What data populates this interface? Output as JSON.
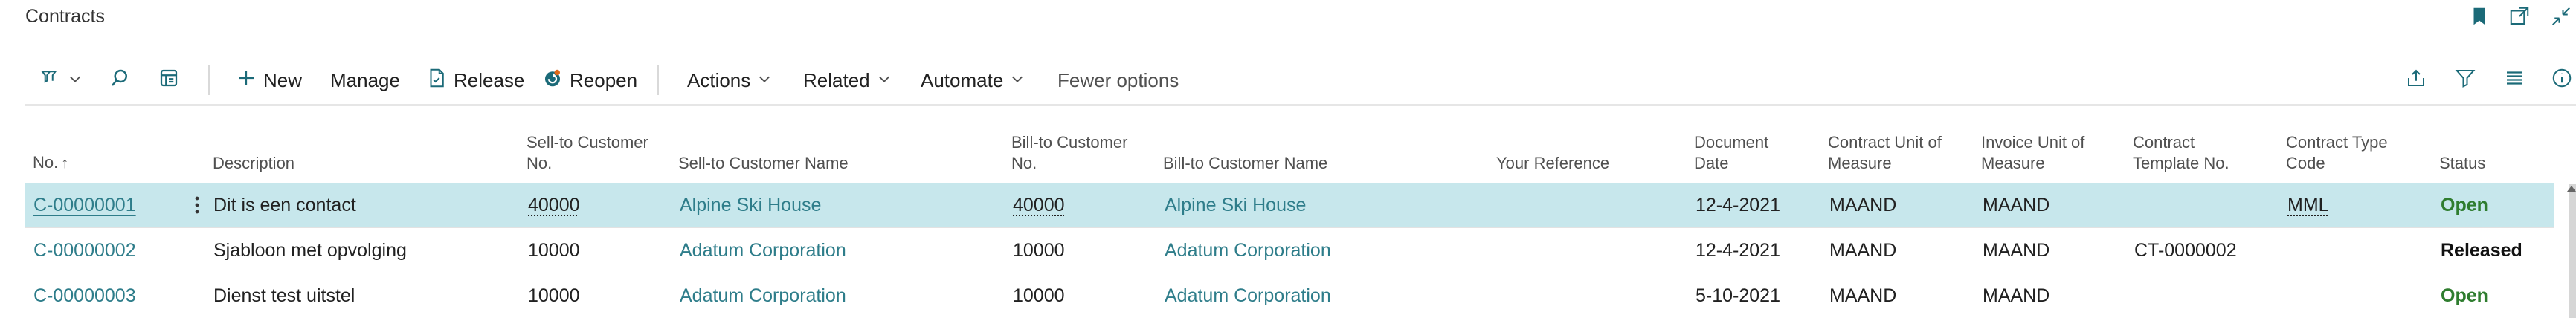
{
  "page": {
    "title": "Contracts"
  },
  "title_icons": [
    "bookmark-icon",
    "open-new-window-icon",
    "collapse-icon"
  ],
  "actionbar": {
    "new_label": "New",
    "manage_label": "Manage",
    "release_label": "Release",
    "reopen_label": "Reopen",
    "actions_label": "Actions",
    "related_label": "Related",
    "automate_label": "Automate",
    "fewer_options_label": "Fewer options"
  },
  "table": {
    "headers": {
      "no": "No.",
      "sort_indicator": "↑",
      "description": "Description",
      "sell_to_no_line1": "Sell-to Customer",
      "sell_to_no_line2": "No.",
      "sell_to_name": "Sell-to Customer Name",
      "bill_to_no_line1": "Bill-to Customer",
      "bill_to_no_line2": "No.",
      "bill_to_name": "Bill-to Customer Name",
      "your_reference": "Your Reference",
      "doc_date_line1": "Document",
      "doc_date_line2": "Date",
      "contract_uom_line1": "Contract Unit of",
      "contract_uom_line2": "Measure",
      "invoice_uom_line1": "Invoice Unit of",
      "invoice_uom_line2": "Measure",
      "template_line1": "Contract",
      "template_line2": "Template No.",
      "type_code_line1": "Contract Type",
      "type_code_line2": "Code",
      "status": "Status"
    },
    "rows": [
      {
        "no": "C-00000001",
        "description": "Dit is een contact",
        "sell_to_no": "40000",
        "sell_to_name": "Alpine Ski House",
        "bill_to_no": "40000",
        "bill_to_name": "Alpine Ski House",
        "your_reference": "",
        "document_date": "12-4-2021",
        "contract_uom": "MAAND",
        "invoice_uom": "MAAND",
        "template_no": "",
        "type_code": "MML",
        "status": "Open"
      },
      {
        "no": "C-00000002",
        "description": "Sjabloon met opvolging",
        "sell_to_no": "10000",
        "sell_to_name": "Adatum Corporation",
        "bill_to_no": "10000",
        "bill_to_name": "Adatum Corporation",
        "your_reference": "",
        "document_date": "12-4-2021",
        "contract_uom": "MAAND",
        "invoice_uom": "MAAND",
        "template_no": "CT-0000002",
        "type_code": "",
        "status": "Released"
      },
      {
        "no": "C-00000003",
        "description": "Dienst test uitstel",
        "sell_to_no": "10000",
        "sell_to_name": "Adatum Corporation",
        "bill_to_no": "10000",
        "bill_to_name": "Adatum Corporation",
        "your_reference": "",
        "document_date": "5-10-2021",
        "contract_uom": "MAAND",
        "invoice_uom": "MAAND",
        "template_no": "",
        "type_code": "",
        "status": "Open"
      }
    ]
  },
  "colors": {
    "accent_link": "#2e7d8a",
    "selected_row": "#c7e7ec",
    "status_open": "#2f7d2f",
    "status_released": "#111111"
  }
}
